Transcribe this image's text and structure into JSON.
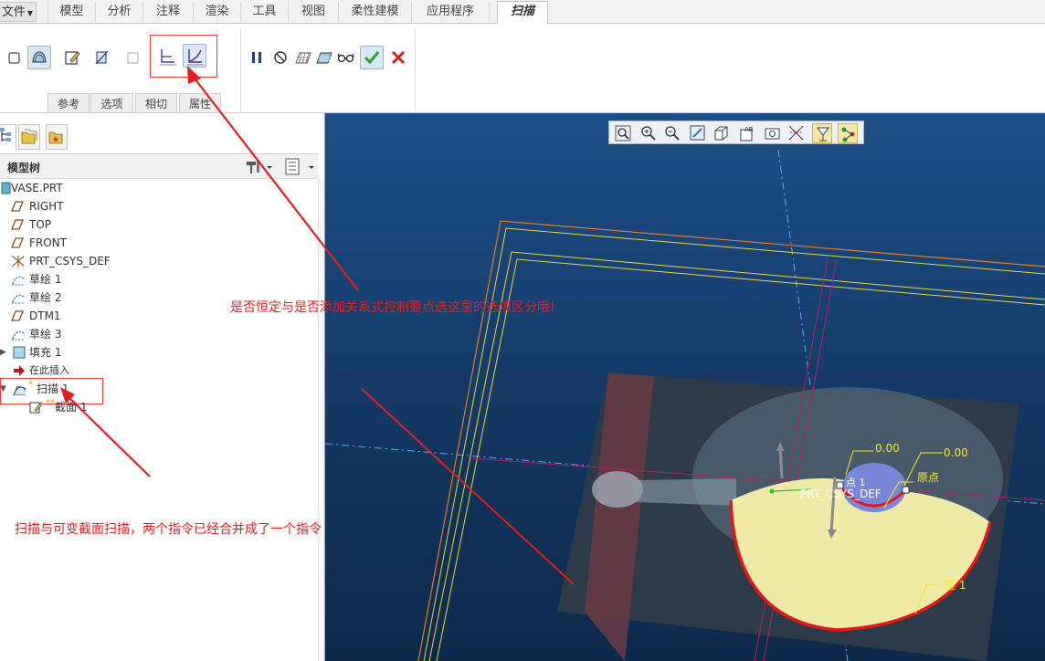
{
  "menu": {
    "file": "文件",
    "tabs": [
      "模型",
      "分析",
      "注释",
      "渲染",
      "工具",
      "视图",
      "柔性建模",
      "应用程序"
    ],
    "active_tab": "扫描"
  },
  "ribbon": {
    "subtabs": [
      "参考",
      "选项",
      "相切",
      "属性"
    ]
  },
  "model_tree": {
    "title": "模型树",
    "items": [
      "VASE.PRT",
      "RIGHT",
      "TOP",
      "FRONT",
      "PRT_CSYS_DEF",
      "草绘 1",
      "草绘 2",
      "DTM1",
      "草绘 3",
      "填充 1",
      "在此插入",
      "扫描 1",
      "截面 1"
    ]
  },
  "viewport": {
    "labels": {
      "dim1": "0.00",
      "dim2": "0.00",
      "origin": "原点",
      "chain": "链 1",
      "csys": "PRT_CSYS_DEF",
      "point": "点 1"
    }
  },
  "annotations": {
    "note1": "是否恒定与是否添加关系式控制要点选这里的选项区分哦!",
    "note2": "扫描与可变截面扫描，两个指令已经合并成了一个指令"
  },
  "colors": {
    "accent_red": "#e02020",
    "viewport_bg": "#164271",
    "dim_yellow": "#f4ec20",
    "confirm_green": "#2e9e2e"
  }
}
